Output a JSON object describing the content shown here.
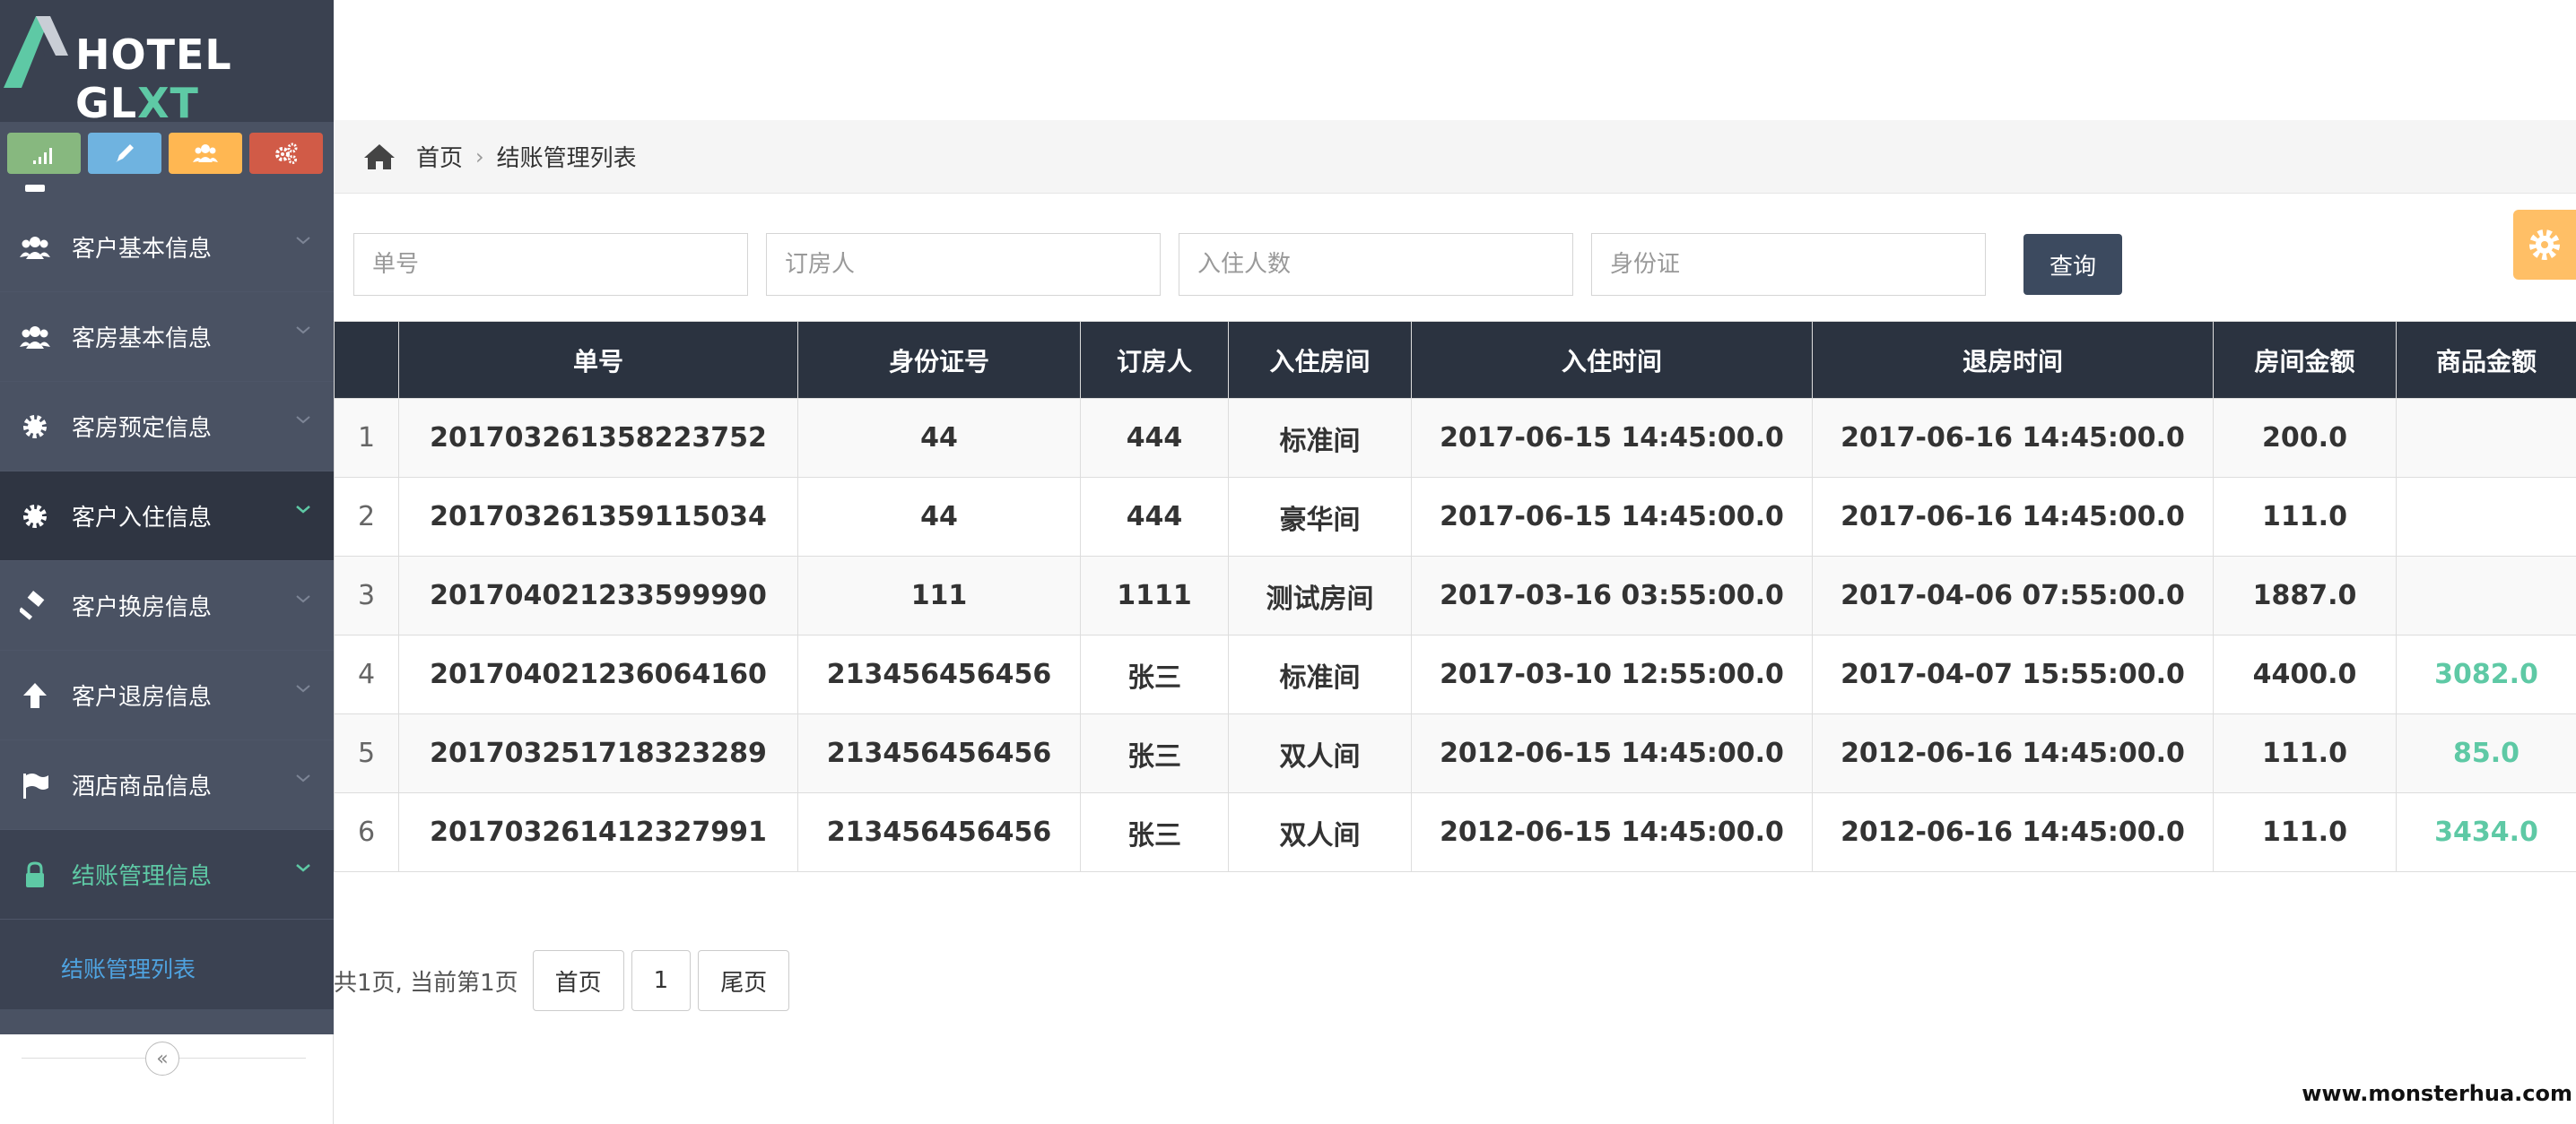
{
  "app": {
    "logo_main": "HOTEL GL",
    "logo_accent": "XT"
  },
  "colors": {
    "sidebar": "#4a5263",
    "accent": "#5ec9a5",
    "header_row": "#2b3340",
    "link": "#4fa3e0"
  },
  "shortcuts": [
    {
      "icon": "signal-icon"
    },
    {
      "icon": "pencil-icon"
    },
    {
      "icon": "users-icon"
    },
    {
      "icon": "cogs-icon"
    }
  ],
  "sidebar": {
    "items": [
      {
        "label": "客户基本信息",
        "icon": "users-icon"
      },
      {
        "label": "客房基本信息",
        "icon": "users-icon"
      },
      {
        "label": "客房预定信息",
        "icon": "cog-icon"
      },
      {
        "label": "客户入住信息",
        "icon": "cog-icon"
      },
      {
        "label": "客户换房信息",
        "icon": "gavel-icon"
      },
      {
        "label": "客户退房信息",
        "icon": "arrow-up-icon"
      },
      {
        "label": "酒店商品信息",
        "icon": "flag-icon"
      },
      {
        "label": "结账管理信息",
        "icon": "lock-icon"
      }
    ],
    "submenu": {
      "label": "结账管理列表"
    },
    "collapse_symbol": "«"
  },
  "breadcrumb": {
    "home": "首页",
    "separator": "›",
    "current": "结账管理列表"
  },
  "filters": {
    "order_no_placeholder": "单号",
    "booker_placeholder": "订房人",
    "guests_placeholder": "入住人数",
    "id_card_placeholder": "身份证",
    "query_label": "查询"
  },
  "table": {
    "headers": [
      "",
      "单号",
      "身份证号",
      "订房人",
      "入住房间",
      "入住时间",
      "退房时间",
      "房间金额",
      "商品金额"
    ],
    "rows": [
      [
        "1",
        "201703261358223752",
        "44",
        "444",
        "标准间",
        "2017-06-15 14:45:00.0",
        "2017-06-16 14:45:00.0",
        "200.0",
        ""
      ],
      [
        "2",
        "201703261359115034",
        "44",
        "444",
        "豪华间",
        "2017-06-15 14:45:00.0",
        "2017-06-16 14:45:00.0",
        "111.0",
        ""
      ],
      [
        "3",
        "201704021233599990",
        "111",
        "1111",
        "测试房间",
        "2017-03-16 03:55:00.0",
        "2017-04-06 07:55:00.0",
        "1887.0",
        ""
      ],
      [
        "4",
        "201704021236064160",
        "213456456456",
        "张三",
        "标准间",
        "2017-03-10 12:55:00.0",
        "2017-04-07 15:55:00.0",
        "4400.0",
        "3082.0"
      ],
      [
        "5",
        "201703251718323289",
        "213456456456",
        "张三",
        "双人间",
        "2012-06-15 14:45:00.0",
        "2012-06-16 14:45:00.0",
        "111.0",
        "85.0"
      ],
      [
        "6",
        "201703261412327991",
        "213456456456",
        "张三",
        "双人间",
        "2012-06-15 14:45:00.0",
        "2012-06-16 14:45:00.0",
        "111.0",
        "3434.0"
      ]
    ]
  },
  "pager": {
    "info": "共1页, 当前第1页",
    "first": "首页",
    "current_page": "1",
    "last": "尾页"
  },
  "watermark": "www.monsterhua.com"
}
